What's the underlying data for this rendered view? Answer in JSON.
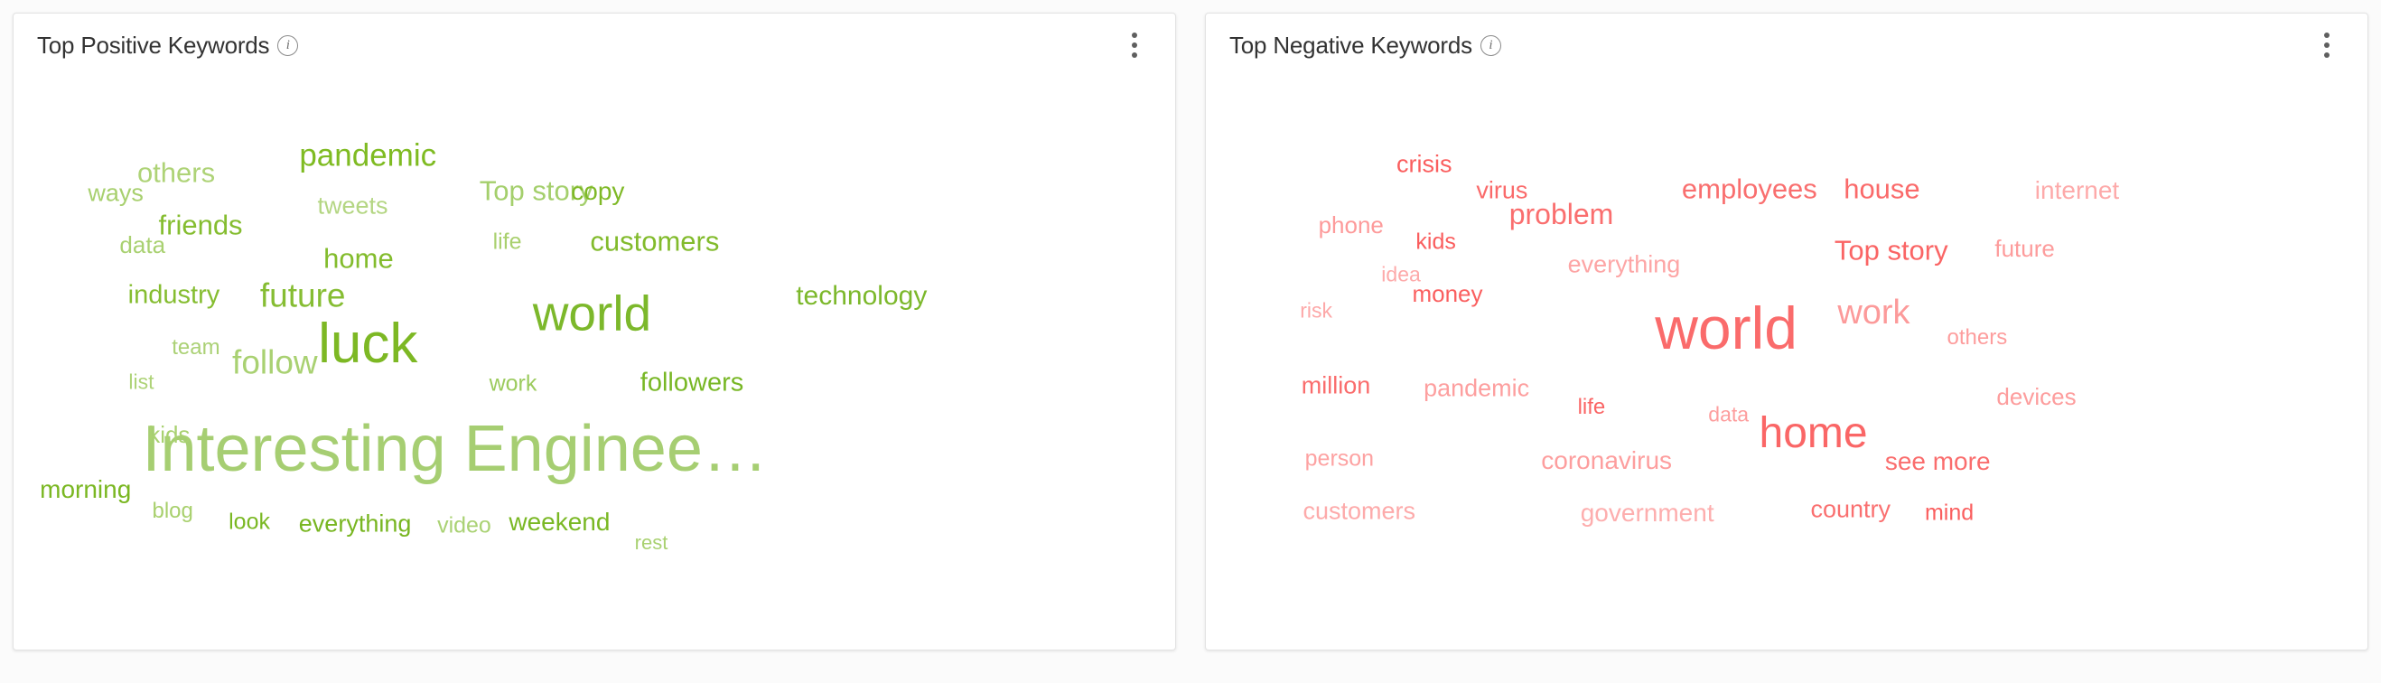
{
  "panels": [
    {
      "id": "top-positive-keywords",
      "title": "Top Positive Keywords",
      "info_icon": "info-icon",
      "menu_icon": "kebab-menu-icon",
      "accent": "#76b72a",
      "chart_data": {
        "type": "wordcloud",
        "title": "Top Positive Keywords",
        "sentiment": "positive",
        "color_scale": [
          "#a8d06a",
          "#b8d97f",
          "#8cc63f",
          "#76b72a",
          "#9ccb5e"
        ],
        "words": [
          {
            "text": "Interesting Enginee…",
            "weight": 100,
            "size": 72,
            "color": "#a6ce72",
            "x": 38.0,
            "y": 68.5
          },
          {
            "text": "luck",
            "weight": 82,
            "size": 62,
            "color": "#7db824",
            "x": 30.5,
            "y": 52.0
          },
          {
            "text": "world",
            "weight": 74,
            "size": 55,
            "color": "#7cb82b",
            "x": 49.8,
            "y": 47.2
          },
          {
            "text": "pandemic",
            "weight": 52,
            "size": 35,
            "color": "#7fbb22",
            "x": 30.5,
            "y": 22.3
          },
          {
            "text": "future",
            "weight": 50,
            "size": 37,
            "color": "#86bd33",
            "x": 24.9,
            "y": 44.3
          },
          {
            "text": "follow",
            "weight": 48,
            "size": 37,
            "color": "#a9d172",
            "x": 22.5,
            "y": 54.8
          },
          {
            "text": "customers",
            "weight": 46,
            "size": 31,
            "color": "#82bb2c",
            "x": 55.2,
            "y": 35.8
          },
          {
            "text": "technology",
            "weight": 45,
            "size": 30,
            "color": "#7cb82b",
            "x": 73.0,
            "y": 44.5
          },
          {
            "text": "friends",
            "weight": 44,
            "size": 31,
            "color": "#85bd30",
            "x": 16.1,
            "y": 33.2
          },
          {
            "text": "others",
            "weight": 42,
            "size": 31,
            "color": "#aed377",
            "x": 14.0,
            "y": 25.0
          },
          {
            "text": "Top story",
            "weight": 42,
            "size": 31,
            "color": "#a4cf6c",
            "x": 45.0,
            "y": 27.8
          },
          {
            "text": "home",
            "weight": 41,
            "size": 31,
            "color": "#83bc2d",
            "x": 29.7,
            "y": 38.5
          },
          {
            "text": "followers",
            "weight": 40,
            "size": 29,
            "color": "#78b725",
            "x": 58.4,
            "y": 58.1
          },
          {
            "text": "industry",
            "weight": 40,
            "size": 29,
            "color": "#85bd30",
            "x": 13.8,
            "y": 44.3
          },
          {
            "text": "everything",
            "weight": 38,
            "size": 27,
            "color": "#78b621",
            "x": 29.4,
            "y": 80.2
          },
          {
            "text": "weekend",
            "weight": 38,
            "size": 28,
            "color": "#7ab824",
            "x": 47.0,
            "y": 80.0
          },
          {
            "text": "morning",
            "weight": 37,
            "size": 28,
            "color": "#7ab722",
            "x": 6.2,
            "y": 74.8
          },
          {
            "text": "tweets",
            "weight": 36,
            "size": 27,
            "color": "#b4d683",
            "x": 29.2,
            "y": 30.3
          },
          {
            "text": "copy",
            "weight": 36,
            "size": 28,
            "color": "#7fb927",
            "x": 50.3,
            "y": 28.0
          },
          {
            "text": "ways",
            "weight": 35,
            "size": 27,
            "color": "#a8d06f",
            "x": 8.8,
            "y": 28.2
          },
          {
            "text": "kids",
            "weight": 34,
            "size": 26,
            "color": "#a9d171",
            "x": 13.4,
            "y": 66.2
          },
          {
            "text": "video",
            "weight": 33,
            "size": 25,
            "color": "#aad274",
            "x": 38.8,
            "y": 80.5
          },
          {
            "text": "look",
            "weight": 33,
            "size": 25,
            "color": "#7ab823",
            "x": 20.3,
            "y": 80.0
          },
          {
            "text": "data",
            "weight": 32,
            "size": 26,
            "color": "#a9d171",
            "x": 11.1,
            "y": 36.3
          },
          {
            "text": "team",
            "weight": 32,
            "size": 24,
            "color": "#abd175",
            "x": 15.7,
            "y": 52.6
          },
          {
            "text": "work",
            "weight": 31,
            "size": 25,
            "color": "#9ccb5e",
            "x": 43.0,
            "y": 58.2
          },
          {
            "text": "life",
            "weight": 30,
            "size": 25,
            "color": "#a9d06e",
            "x": 42.5,
            "y": 36.0
          },
          {
            "text": "blog",
            "weight": 29,
            "size": 24,
            "color": "#a8d06d",
            "x": 13.7,
            "y": 78.2
          },
          {
            "text": "list",
            "weight": 27,
            "size": 23,
            "color": "#aed378",
            "x": 11.0,
            "y": 58.0
          },
          {
            "text": "rest",
            "weight": 26,
            "size": 22,
            "color": "#a9d171",
            "x": 54.9,
            "y": 83.2
          }
        ]
      }
    },
    {
      "id": "top-negative-keywords",
      "title": "Top Negative Keywords",
      "info_icon": "info-icon",
      "menu_icon": "kebab-menu-icon",
      "accent": "#f86d6d",
      "chart_data": {
        "type": "wordcloud",
        "title": "Top Negative Keywords",
        "sentiment": "negative",
        "color_scale": [
          "#fa7b7b",
          "#f96d6d",
          "#fda6a6",
          "#fbb6b6",
          "#f95a5a"
        ],
        "words": [
          {
            "text": "world",
            "weight": 100,
            "size": 66,
            "color": "#fa6b6b",
            "x": 44.8,
            "y": 49.5
          },
          {
            "text": "home",
            "weight": 76,
            "size": 48,
            "color": "#fa6666",
            "x": 52.3,
            "y": 66.0
          },
          {
            "text": "work",
            "weight": 54,
            "size": 38,
            "color": "#fc9a9a",
            "x": 57.5,
            "y": 47.0
          },
          {
            "text": "employees",
            "weight": 48,
            "size": 31,
            "color": "#f96f6f",
            "x": 46.8,
            "y": 27.5
          },
          {
            "text": "problem",
            "weight": 46,
            "size": 32,
            "color": "#fa6e6e",
            "x": 30.6,
            "y": 31.6
          },
          {
            "text": "house",
            "weight": 45,
            "size": 31,
            "color": "#fa6a6a",
            "x": 58.2,
            "y": 27.5
          },
          {
            "text": "Top story",
            "weight": 43,
            "size": 31,
            "color": "#fa6565",
            "x": 59.0,
            "y": 37.2
          },
          {
            "text": "see more",
            "weight": 40,
            "size": 28,
            "color": "#fa6d6d",
            "x": 63.0,
            "y": 70.5
          },
          {
            "text": "coronavirus",
            "weight": 39,
            "size": 28,
            "color": "#fd9e9e",
            "x": 34.5,
            "y": 70.3
          },
          {
            "text": "internet",
            "weight": 38,
            "size": 28,
            "color": "#fdaaaa",
            "x": 75.0,
            "y": 27.8
          },
          {
            "text": "government",
            "weight": 38,
            "size": 28,
            "color": "#fdaeae",
            "x": 38.0,
            "y": 78.5
          },
          {
            "text": "everything",
            "weight": 37,
            "size": 27,
            "color": "#fda5a5",
            "x": 36.0,
            "y": 39.5
          },
          {
            "text": "pandemic",
            "weight": 36,
            "size": 27,
            "color": "#fd9f9f",
            "x": 23.3,
            "y": 59.0
          },
          {
            "text": "customers",
            "weight": 36,
            "size": 27,
            "color": "#fdaaaa",
            "x": 13.2,
            "y": 78.3
          },
          {
            "text": "country",
            "weight": 35,
            "size": 27,
            "color": "#fa7070",
            "x": 55.5,
            "y": 78.0
          },
          {
            "text": "million",
            "weight": 34,
            "size": 27,
            "color": "#fa6c6c",
            "x": 11.2,
            "y": 58.5
          },
          {
            "text": "devices",
            "weight": 34,
            "size": 26,
            "color": "#fd9d9d",
            "x": 71.5,
            "y": 60.2
          },
          {
            "text": "crisis",
            "weight": 33,
            "size": 27,
            "color": "#fa5e5e",
            "x": 18.8,
            "y": 23.7
          },
          {
            "text": "virus",
            "weight": 33,
            "size": 27,
            "color": "#fa6a6a",
            "x": 25.5,
            "y": 27.8
          },
          {
            "text": "money",
            "weight": 32,
            "size": 26,
            "color": "#fa5f5f",
            "x": 20.8,
            "y": 44.0
          },
          {
            "text": "future",
            "weight": 32,
            "size": 26,
            "color": "#fd9c9c",
            "x": 70.5,
            "y": 37.0
          },
          {
            "text": "phone",
            "weight": 31,
            "size": 26,
            "color": "#fd9a9a",
            "x": 12.5,
            "y": 33.2
          },
          {
            "text": "others",
            "weight": 30,
            "size": 24,
            "color": "#fd9d9d",
            "x": 66.4,
            "y": 51.0
          },
          {
            "text": "person",
            "weight": 30,
            "size": 25,
            "color": "#fda2a2",
            "x": 11.5,
            "y": 70.0
          },
          {
            "text": "kids",
            "weight": 29,
            "size": 25,
            "color": "#fa5d5d",
            "x": 19.8,
            "y": 36.0
          },
          {
            "text": "mind",
            "weight": 28,
            "size": 25,
            "color": "#fa5f5f",
            "x": 64.0,
            "y": 78.5
          },
          {
            "text": "life",
            "weight": 27,
            "size": 24,
            "color": "#fa6565",
            "x": 33.2,
            "y": 62.0
          },
          {
            "text": "data",
            "weight": 26,
            "size": 23,
            "color": "#fd9e9e",
            "x": 45.0,
            "y": 63.0
          },
          {
            "text": "idea",
            "weight": 25,
            "size": 23,
            "color": "#fdaaaa",
            "x": 16.8,
            "y": 41.0
          },
          {
            "text": "risk",
            "weight": 24,
            "size": 23,
            "color": "#fda8a8",
            "x": 9.5,
            "y": 46.8
          }
        ]
      }
    }
  ]
}
